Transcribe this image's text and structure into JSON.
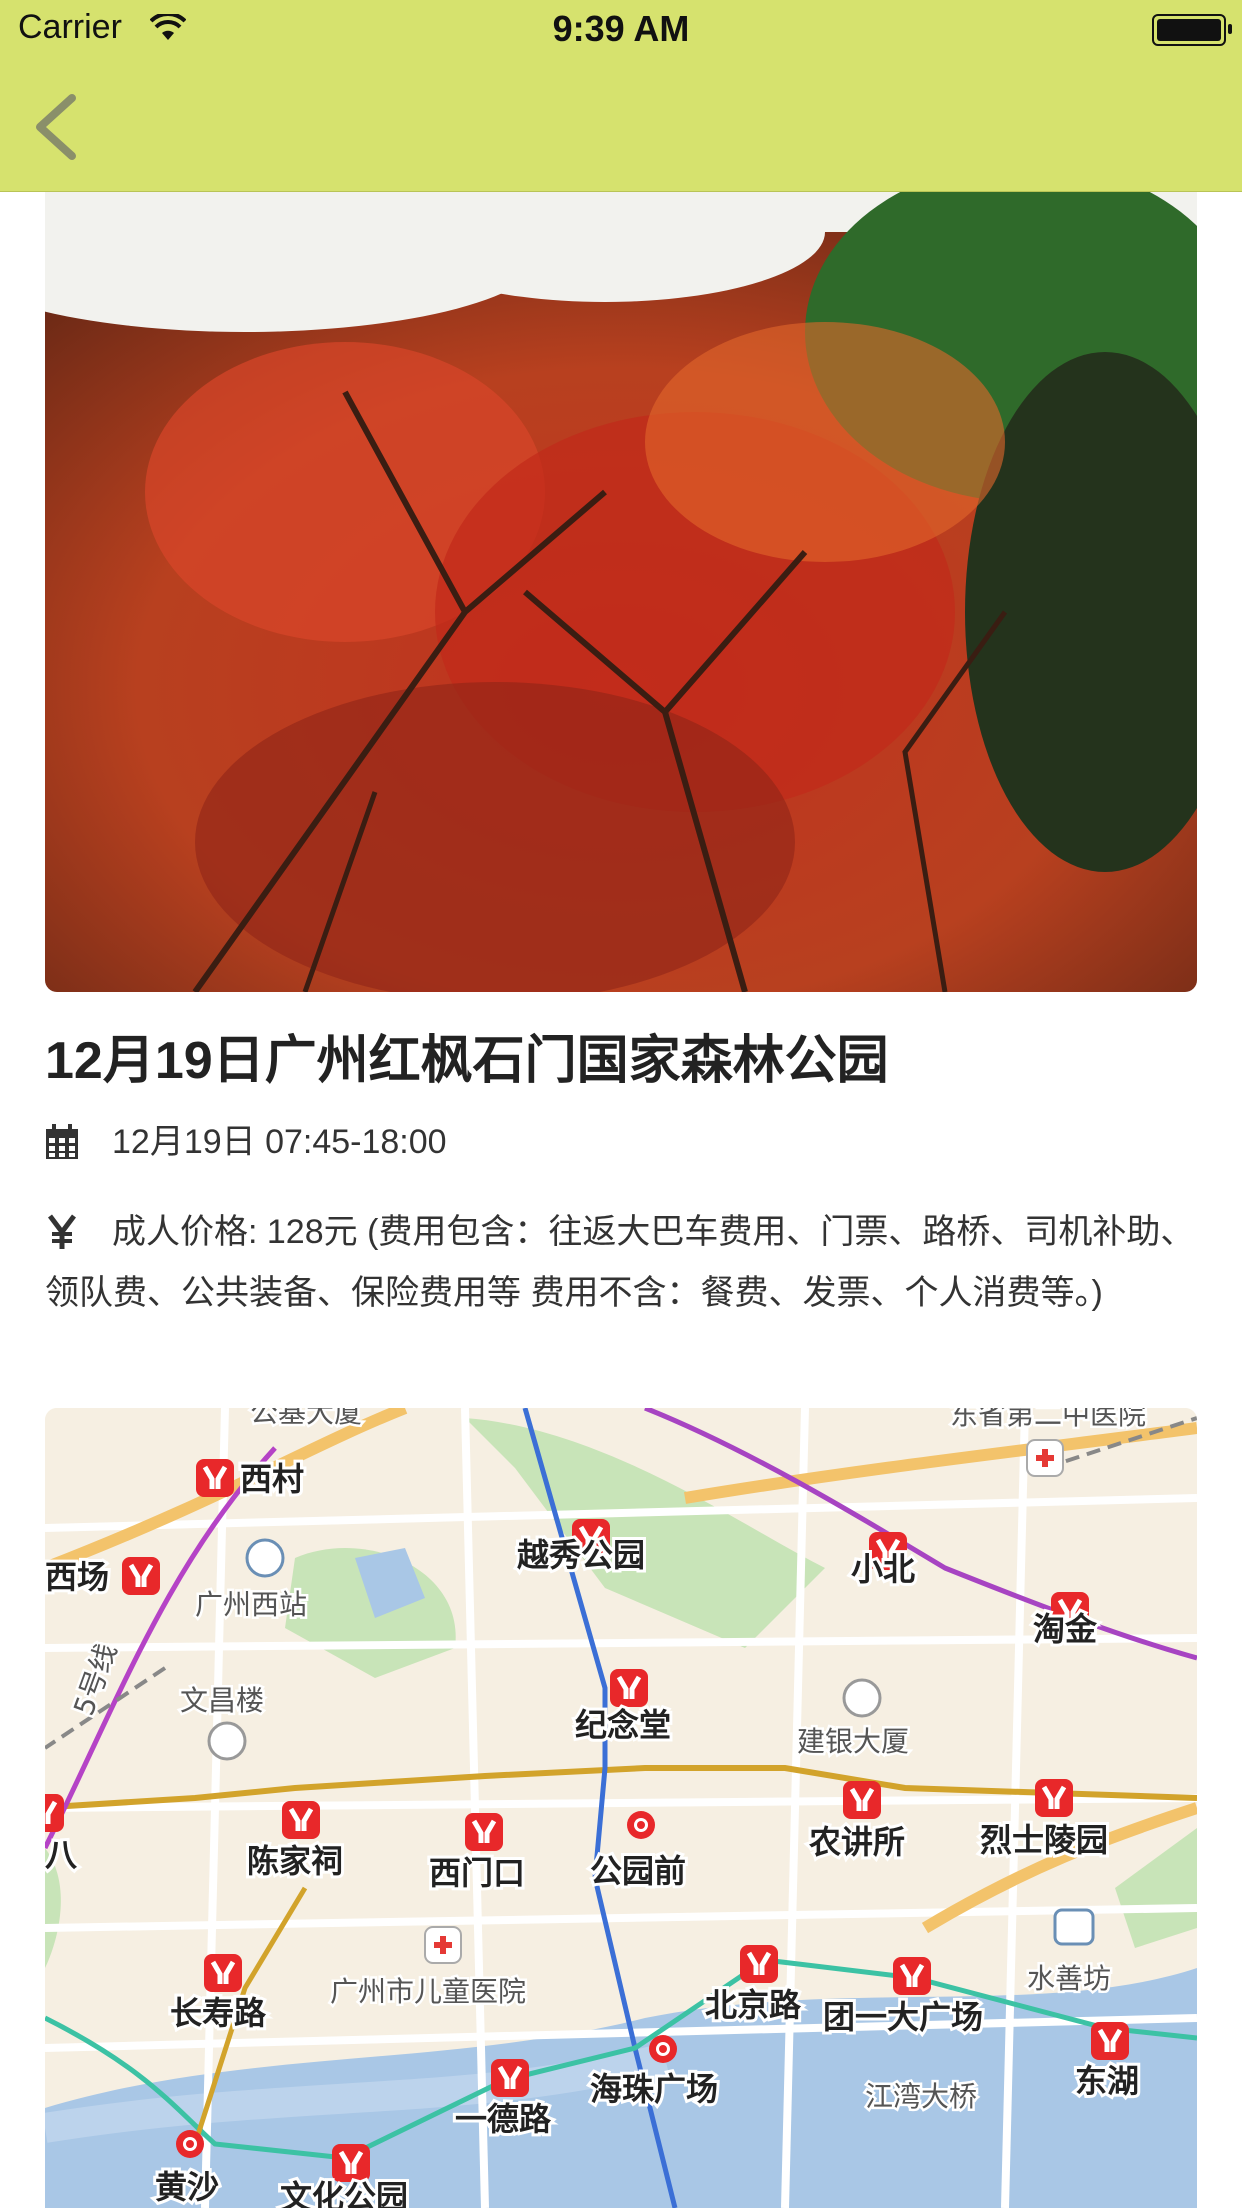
{
  "status_bar": {
    "carrier": "Carrier",
    "time": "9:39 AM"
  },
  "nav": {
    "back_icon": "chevron-left-icon"
  },
  "event": {
    "title": "12月19日广州红枫石门国家森林公园",
    "date_time": "12月19日 07:45-18:00",
    "price_text": "成人价格: 128元 (费用包含：往返大巴车费用、门票、路桥、司机补助、领队费、公共装备、保险费用等 费用不含：餐费、发票、个人消费等。)"
  },
  "map": {
    "stations": {
      "xicun": "西村",
      "xichang": "西场",
      "yuexiu": "越秀公园",
      "xiaobei": "小北",
      "taojin": "淘金",
      "jiniantang": "纪念堂",
      "chenjiaci": "陈家祠",
      "ximenkou": "西门口",
      "gongyuanqian": "公园前",
      "nongjiangsuo": "农讲所",
      "lieshi": "烈士陵园",
      "changshou": "长寿路",
      "beijinglu": "北京路",
      "tuanyi": "团一大广场",
      "dongshan": "东湖",
      "haizhu": "海珠广场",
      "yidelu": "一德路",
      "huangsha": "黄沙",
      "wenhua": "文化公园",
      "edge8": "八"
    },
    "pois": {
      "guangzhou_west": "广州西站",
      "wenchang": "文昌楼",
      "jianyin": "建银大厦",
      "childrens": "广州市儿童医院",
      "shuishanfang": "水善坊",
      "jiangwan": "江湾大桥",
      "top_left": "公基大厦",
      "top_right": "东省第二中医院",
      "line5": "5号线"
    }
  }
}
